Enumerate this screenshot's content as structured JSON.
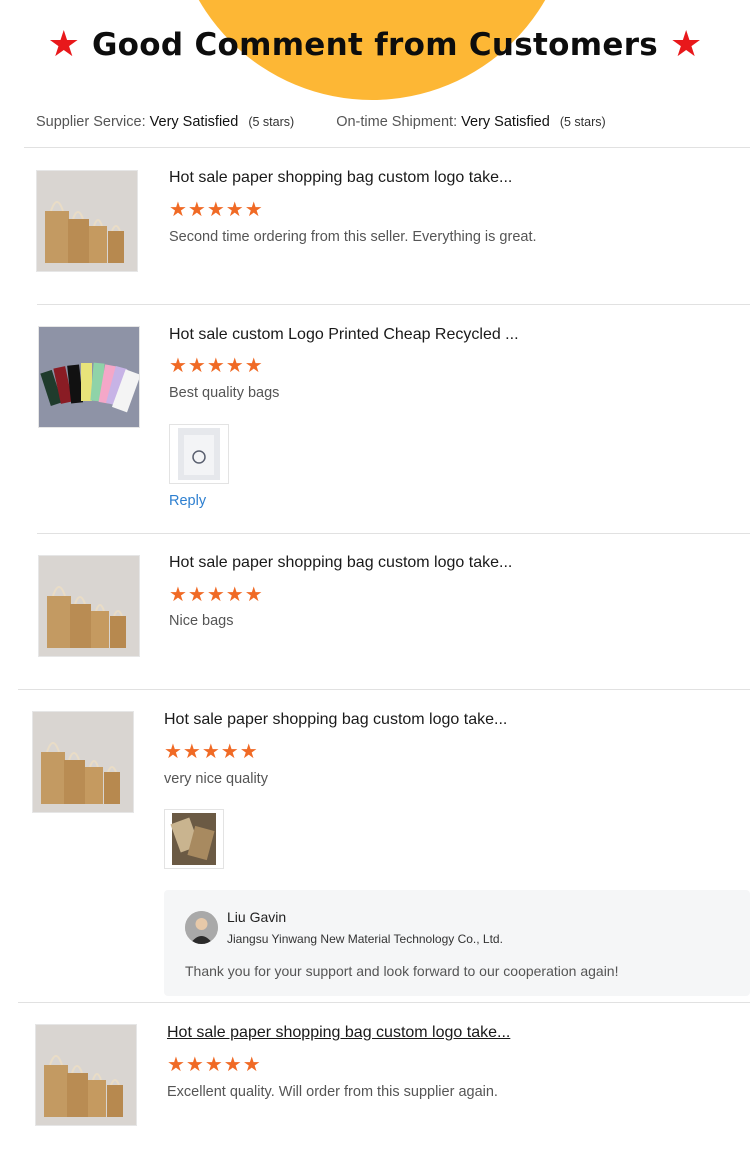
{
  "banner": {
    "star": "★",
    "title": "Good Comment from Customers"
  },
  "summary": {
    "supplier_label": "Supplier Service:",
    "supplier_value": "Very Satisfied",
    "supplier_stars": "(5 stars)",
    "shipment_label": "On-time Shipment:",
    "shipment_value": "Very Satisfied",
    "shipment_stars": "(5 stars)"
  },
  "reviews": [
    {
      "title": "Hot sale paper shopping bag custom logo take...",
      "stars": "★★★★★",
      "rating": 5,
      "text": "Second time ordering from this seller. Everything is great."
    },
    {
      "title": "Hot sale custom Logo Printed Cheap Recycled ...",
      "stars": "★★★★★",
      "rating": 5,
      "text": "Best quality bags",
      "reply_label": "Reply"
    },
    {
      "title": "Hot sale paper shopping bag custom logo take...",
      "stars": "★★★★★",
      "rating": 5,
      "text": "Nice bags"
    },
    {
      "title": "Hot sale paper shopping bag custom logo take...",
      "stars": "★★★★★",
      "rating": 5,
      "text": "very nice quality",
      "supplier_reply": {
        "name": "Liu Gavin",
        "company": "Jiangsu Yinwang New Material Technology Co., Ltd.",
        "message": "Thank you for your support and look forward to our cooperation again!"
      }
    },
    {
      "title": "Hot sale paper shopping bag custom logo take...",
      "stars": "★★★★★",
      "rating": 5,
      "text": "Excellent quality. Will order from this supplier again."
    }
  ],
  "colors": {
    "accent_star": "#f06a25",
    "banner_star": "#e8181b",
    "halo": "#fdb735",
    "link": "#2d7fd0"
  }
}
